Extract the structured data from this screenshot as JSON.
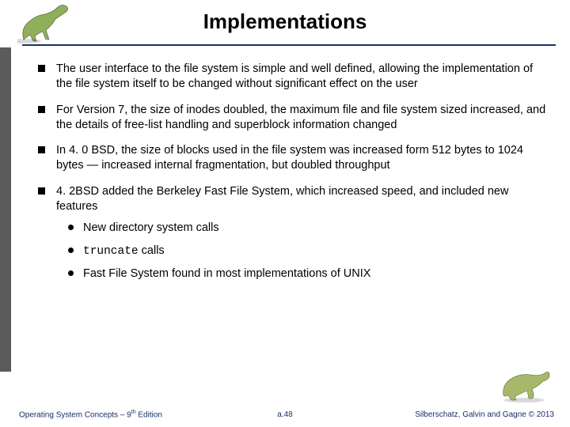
{
  "title": "Implementations",
  "bullets": [
    "The user interface to the file system is simple and well defined, allowing the implementation of the file system itself to be changed without significant effect on the user",
    "For Version 7, the size of inodes doubled, the maximum file and file system sized increased, and the details of free-list handling and superblock information changed",
    "In 4. 0 BSD, the size of blocks used in the file system was increased form 512 bytes to 1024 bytes — increased internal fragmentation, but doubled throughput",
    "4. 2BSD added the Berkeley Fast File System, which increased speed, and included new features"
  ],
  "subbullets": [
    "New directory system calls",
    {
      "code": "truncate",
      "rest": " calls"
    },
    "Fast File System found in most implementations of UNIX"
  ],
  "footer": {
    "left_pre": "Operating System Concepts – 9",
    "left_sup": "th",
    "left_post": " Edition",
    "center": "a.48",
    "right": "Silberschatz, Galvin and Gagne © 2013"
  },
  "icons": {
    "dino_top": "dinosaur-running-icon",
    "dino_bottom": "dinosaur-crouching-icon"
  }
}
